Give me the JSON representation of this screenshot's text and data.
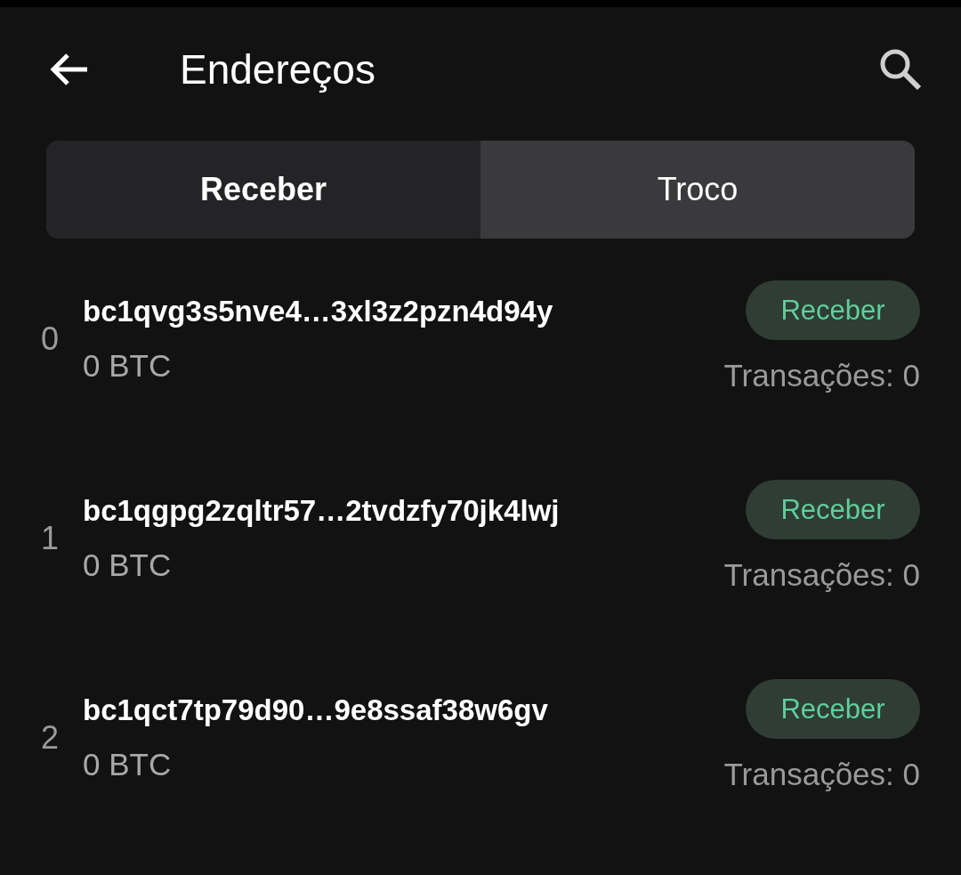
{
  "header": {
    "title": "Endereços"
  },
  "tabs": [
    {
      "label": "Receber",
      "selected": true
    },
    {
      "label": "Troco",
      "selected": false
    }
  ],
  "addresses": [
    {
      "index": "0",
      "address": "bc1qvg3s5nve4…3xl3z2pzn4d94y",
      "balance": "0 BTC",
      "button": "Receber",
      "transactions": "Transações: 0"
    },
    {
      "index": "1",
      "address": "bc1qgpg2zqltr57…2tvdzfy70jk4lwj",
      "balance": "0 BTC",
      "button": "Receber",
      "transactions": "Transações: 0"
    },
    {
      "index": "2",
      "address": "bc1qct7tp79d90…9e8ssaf38w6gv",
      "balance": "0 BTC",
      "button": "Receber",
      "transactions": "Transações: 0"
    }
  ]
}
